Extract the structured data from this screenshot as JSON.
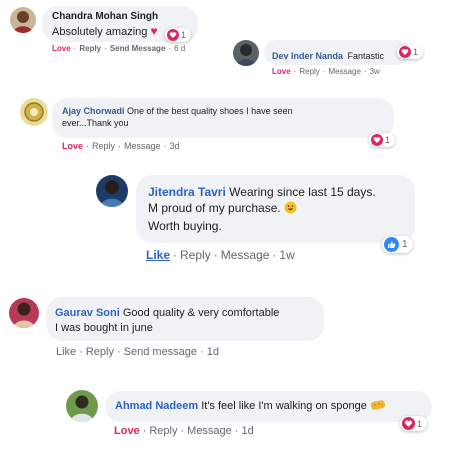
{
  "comments": [
    {
      "author": "Chandra Mohan Singh",
      "text": "Absolutely amazing",
      "reaction_count": "1",
      "actions": {
        "primary": "Love",
        "reply": "Reply",
        "extra": "Send Message",
        "time": "6 d"
      }
    },
    {
      "author": "Dev Inder Nanda",
      "text": "Fantastic",
      "reaction_count": "1",
      "actions": {
        "primary": "Love",
        "reply": "Reply",
        "extra": "Message",
        "time": "3w"
      }
    },
    {
      "author": "Ajay Chorwadi",
      "text_line1": "One of the best quality shoes I have seen",
      "text_line2": "ever...Thank you",
      "reaction_count": "1",
      "actions": {
        "primary": "Love",
        "reply": "Reply",
        "extra": "Message",
        "time": "3d"
      }
    },
    {
      "author": "Jitendra Tavri",
      "text_line1": "Wearing since last 15 days.",
      "text_line2": "M proud of my purchase.",
      "text_line3": "Worth buying.",
      "reaction_count": "1",
      "actions": {
        "primary": "Like",
        "reply": "Reply",
        "extra": "Message",
        "time": "1w"
      }
    },
    {
      "author": "Gaurav Soni",
      "text_line1": "Good quality & very comfortable",
      "text_line2": "I was bought in june",
      "actions": {
        "primary": "Like",
        "reply": "Reply",
        "extra": "Send message",
        "time": "1d"
      }
    },
    {
      "author": "Ahmad Nadeem",
      "text": "It's feel like I'm walking on sponge",
      "reaction_count": "1",
      "actions": {
        "primary": "Love",
        "reply": "Reply",
        "extra": "Message",
        "time": "1d"
      }
    }
  ],
  "separator": "·",
  "colors": {
    "bubble_bg": "#f0f2f5",
    "author": "#385898",
    "author_alt": "#2d63c8",
    "love": "#e0245e",
    "like": "#2d63c8",
    "meta": "#65676b"
  },
  "icons": [
    "heart-icon",
    "like-icon",
    "smile-emoji-icon",
    "sponge-emoji-icon"
  ]
}
